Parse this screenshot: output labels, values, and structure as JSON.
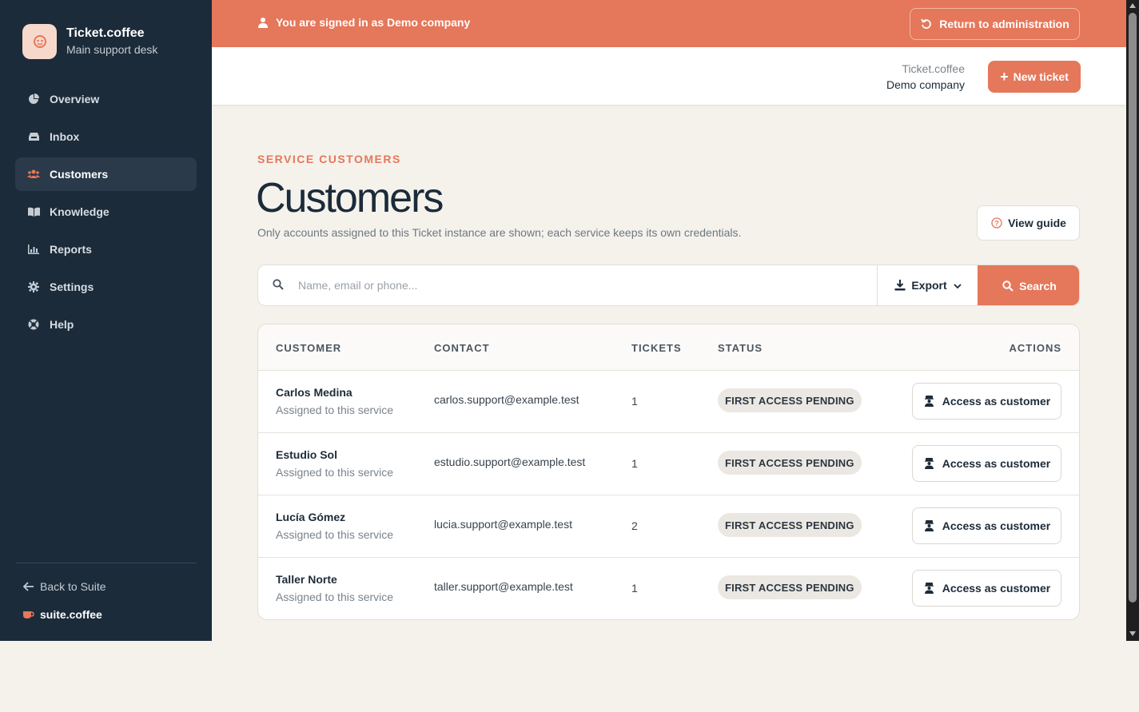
{
  "brand": {
    "name": "Ticket.coffee",
    "subtitle": "Main support desk"
  },
  "nav": {
    "items": [
      {
        "label": "Overview",
        "icon": "pie-chart-icon"
      },
      {
        "label": "Inbox",
        "icon": "inbox-icon"
      },
      {
        "label": "Customers",
        "icon": "users-icon",
        "active": true
      },
      {
        "label": "Knowledge",
        "icon": "book-icon"
      },
      {
        "label": "Reports",
        "icon": "bar-chart-icon"
      },
      {
        "label": "Settings",
        "icon": "gear-icon"
      },
      {
        "label": "Help",
        "icon": "lifebuoy-icon"
      }
    ],
    "back_label": "Back to Suite",
    "suite_label": "suite.coffee"
  },
  "banner": {
    "text": "You are signed in as Demo company",
    "return_label": "Return to administration"
  },
  "topbar": {
    "org_top": "Ticket.coffee",
    "org_bottom": "Demo company",
    "new_ticket_label": "New ticket"
  },
  "page": {
    "eyebrow": "SERVICE CUSTOMERS",
    "title": "Customers",
    "description": "Only accounts assigned to this Ticket instance are shown; each service keeps its own credentials.",
    "guide_label": "View guide"
  },
  "search": {
    "placeholder": "Name, email or phone...",
    "value": "",
    "export_label": "Export",
    "search_label": "Search"
  },
  "table": {
    "headers": [
      "CUSTOMER",
      "CONTACT",
      "TICKETS",
      "STATUS",
      "ACTIONS"
    ],
    "rows": [
      {
        "name": "Carlos Medina",
        "sub": "Assigned to this service",
        "contact": "carlos.support@example.test",
        "tickets": "1",
        "status": "FIRST ACCESS PENDING",
        "action": "Access as customer"
      },
      {
        "name": "Estudio Sol",
        "sub": "Assigned to this service",
        "contact": "estudio.support@example.test",
        "tickets": "1",
        "status": "FIRST ACCESS PENDING",
        "action": "Access as customer"
      },
      {
        "name": "Lucía Gómez",
        "sub": "Assigned to this service",
        "contact": "lucia.support@example.test",
        "tickets": "2",
        "status": "FIRST ACCESS PENDING",
        "action": "Access as customer"
      },
      {
        "name": "Taller Norte",
        "sub": "Assigned to this service",
        "contact": "taller.support@example.test",
        "tickets": "1",
        "status": "FIRST ACCESS PENDING",
        "action": "Access as customer"
      }
    ]
  },
  "colors": {
    "accent": "#e5775a",
    "sidebar": "#1b2b3a",
    "background": "#f5f2ec"
  }
}
